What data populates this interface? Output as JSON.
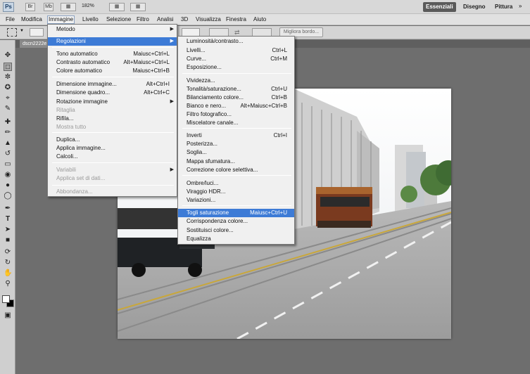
{
  "app": {
    "logo": "Ps",
    "zoom": "182%",
    "mini_buttons": [
      "Br",
      "Mb"
    ]
  },
  "workspaces": [
    "Essenziali",
    "Disegno",
    "Pittura"
  ],
  "menubar": [
    "File",
    "Modifica",
    "Immagine",
    "Livello",
    "Selezione",
    "Filtro",
    "Analisi",
    "3D",
    "Visualizza",
    "Finestra",
    "Aiuto"
  ],
  "options": {
    "refine_button": "Migliora bordo..."
  },
  "document": {
    "tab_title": "dscn2222e"
  },
  "immagine_menu": [
    {
      "label": "Metodo",
      "shortcut": "",
      "submenu": true
    },
    {
      "label": "Regolazioni",
      "shortcut": "",
      "submenu": true,
      "highlighted": true
    },
    {
      "label": "Tono automatico",
      "shortcut": "Maiusc+Ctrl+L"
    },
    {
      "label": "Contrasto automatico",
      "shortcut": "Alt+Maiusc+Ctrl+L"
    },
    {
      "label": "Colore automatico",
      "shortcut": "Maiusc+Ctrl+B"
    },
    {
      "label": "Dimensione immagine...",
      "shortcut": "Alt+Ctrl+I"
    },
    {
      "label": "Dimensione quadro...",
      "shortcut": "Alt+Ctrl+C"
    },
    {
      "label": "Rotazione immagine",
      "shortcut": "",
      "submenu": true
    },
    {
      "label": "Ritaglia",
      "shortcut": "",
      "disabled": true
    },
    {
      "label": "Rifila...",
      "shortcut": ""
    },
    {
      "label": "Mostra tutto",
      "shortcut": "",
      "disabled": true
    },
    {
      "label": "Duplica...",
      "shortcut": ""
    },
    {
      "label": "Applica immagine...",
      "shortcut": ""
    },
    {
      "label": "Calcoli...",
      "shortcut": ""
    },
    {
      "label": "Variabili",
      "shortcut": "",
      "submenu": true,
      "disabled": true
    },
    {
      "label": "Applica set di dati...",
      "shortcut": "",
      "disabled": true
    },
    {
      "label": "Abbondanza...",
      "shortcut": "",
      "disabled": true
    }
  ],
  "regolazioni_menu": [
    {
      "label": "Luminosità/contrasto...",
      "shortcut": ""
    },
    {
      "label": "Livelli...",
      "shortcut": "Ctrl+L"
    },
    {
      "label": "Curve...",
      "shortcut": "Ctrl+M"
    },
    {
      "label": "Esposizione...",
      "shortcut": ""
    },
    {
      "label": "Vividezza...",
      "shortcut": ""
    },
    {
      "label": "Tonalità/saturazione...",
      "shortcut": "Ctrl+U"
    },
    {
      "label": "Bilanciamento colore...",
      "shortcut": "Ctrl+B"
    },
    {
      "label": "Bianco e nero...",
      "shortcut": "Alt+Maiusc+Ctrl+B"
    },
    {
      "label": "Filtro fotografico...",
      "shortcut": ""
    },
    {
      "label": "Miscelatore canale...",
      "shortcut": ""
    },
    {
      "label": "Inverti",
      "shortcut": "Ctrl+I"
    },
    {
      "label": "Posterizza...",
      "shortcut": ""
    },
    {
      "label": "Soglia...",
      "shortcut": ""
    },
    {
      "label": "Mappa sfumatura...",
      "shortcut": ""
    },
    {
      "label": "Correzione colore selettiva...",
      "shortcut": ""
    },
    {
      "label": "Ombre/luci...",
      "shortcut": ""
    },
    {
      "label": "Viraggio HDR...",
      "shortcut": ""
    },
    {
      "label": "Variazioni...",
      "shortcut": ""
    },
    {
      "label": "Togli saturazione",
      "shortcut": "Maiusc+Ctrl+U",
      "highlighted": true
    },
    {
      "label": "Corrispondenza colore...",
      "shortcut": ""
    },
    {
      "label": "Sostituisci colore...",
      "shortcut": ""
    },
    {
      "label": "Equalizza",
      "shortcut": ""
    }
  ],
  "colors": {
    "highlight": "#3d7bd6",
    "menu_bg": "#f0f0f0",
    "canvas_bg": "#6e6e6e"
  }
}
